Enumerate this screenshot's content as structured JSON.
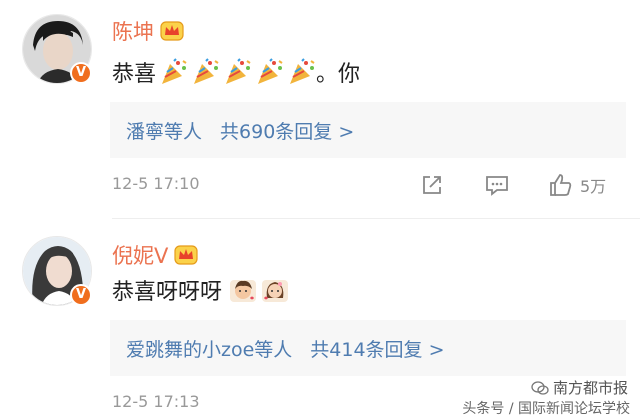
{
  "comments": [
    {
      "author": "陈坤",
      "text_prefix": "恭喜",
      "emojis": [
        "party-popper-icon",
        "party-popper-icon",
        "party-popper-icon",
        "party-popper-icon",
        "party-popper-icon"
      ],
      "text_suffix": "。你",
      "reply_users": "潘寧等人",
      "reply_count": "共690条回复 >",
      "time": "12-5 17:10",
      "like_count": "5万"
    },
    {
      "author": "倪妮V",
      "text_prefix": "恭喜呀呀呀",
      "emojis": [
        "couple-boy-icon",
        "couple-girl-icon"
      ],
      "text_suffix": "",
      "reply_users": "爱跳舞的小zoe等人",
      "reply_count": "共414条回复 >",
      "time": "12-5 17:13",
      "like_count": ""
    }
  ],
  "watermark": {
    "brand": "南方都市报",
    "text": "头条号 / 国际新闻论坛学校"
  },
  "colors": {
    "name": "#eb7350",
    "link": "#4f7cb0",
    "meta": "#999999",
    "reply_bg": "#f7f7f7",
    "badge": "#f06e1e"
  }
}
